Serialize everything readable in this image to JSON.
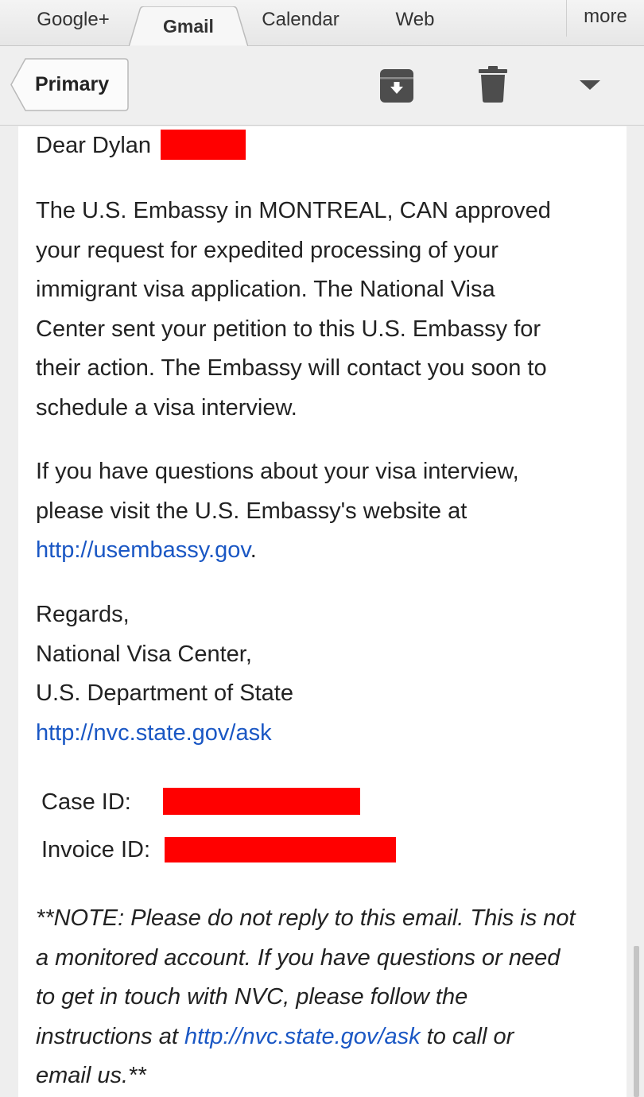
{
  "tabs": {
    "google_plus": "Google+",
    "gmail": "Gmail",
    "calendar": "Calendar",
    "web": "Web",
    "more": "more"
  },
  "actionbar": {
    "back_label": "Primary",
    "archive_icon": "archive-icon",
    "delete_icon": "trash-icon",
    "overflow_icon": "caret-down-icon"
  },
  "email": {
    "greeting": "Dear Dylan",
    "body_lines": [
      "The U.S. Embassy in MONTREAL, CAN approved",
      "your request for expedited processing of your",
      "immigrant visa application. The National Visa",
      "Center sent your petition to this U.S. Embassy for",
      "their action. The Embassy will contact you soon to",
      "schedule a visa interview."
    ],
    "questions_lines": [
      "If you have questions about your visa interview,",
      "please visit the U.S. Embassy's website at"
    ],
    "embassy_link": "http://usembassy.gov",
    "embassy_link_suffix": ".",
    "signoff_lines": [
      "Regards,",
      "National Visa Center,",
      "U.S. Department of State"
    ],
    "signoff_link": "http://nvc.state.gov/ask",
    "case_id_label": "Case ID:",
    "invoice_id_label": "Invoice ID:",
    "note_lines": [
      "**NOTE: Please do not reply to this email. This is not",
      "a monitored account. If you have questions or need",
      "to get in touch with NVC, please follow the"
    ],
    "note_prefix": "instructions at ",
    "note_link": "http://nvc.state.gov/ask",
    "note_suffix": " to call or",
    "note_last": "email us.**"
  },
  "colors": {
    "link": "#1a57c4",
    "redaction": "#ff0000"
  }
}
